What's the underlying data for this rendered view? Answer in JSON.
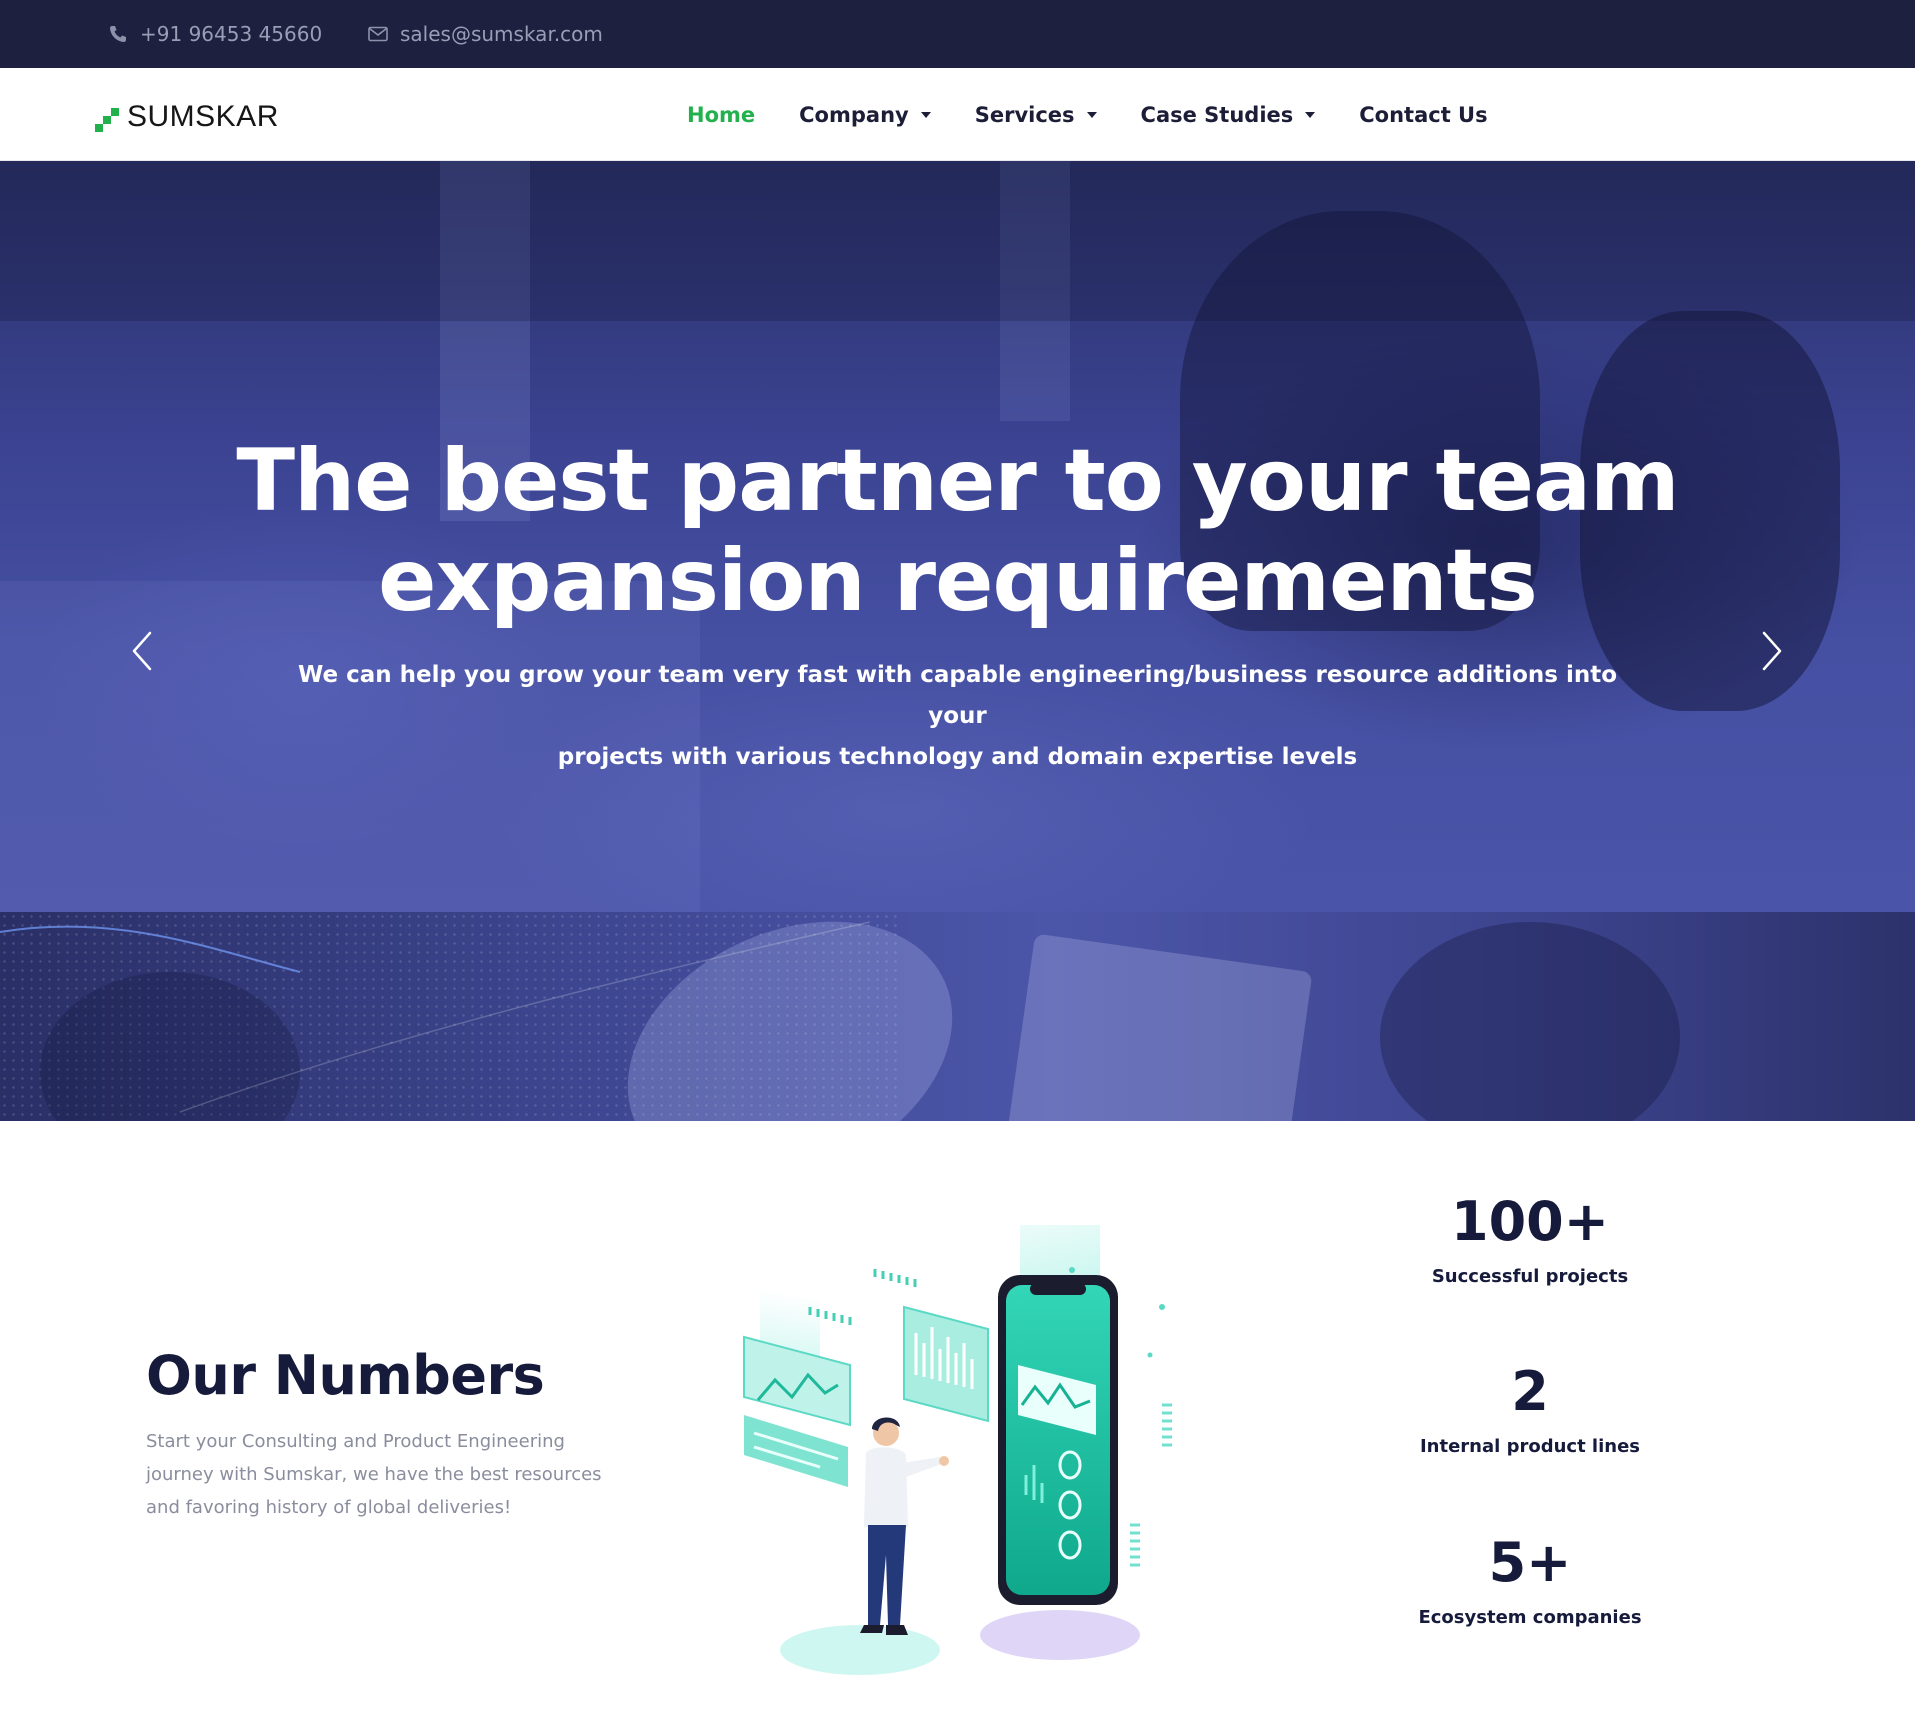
{
  "topbar": {
    "phone": "+91 96453 45660",
    "email": "sales@sumskar.com"
  },
  "brand": {
    "logo_text": "SUMSKAR",
    "accent_color": "#22b14c"
  },
  "nav": {
    "items": [
      {
        "label": "Home",
        "active": true,
        "dropdown": false
      },
      {
        "label": "Company",
        "active": false,
        "dropdown": true
      },
      {
        "label": "Services",
        "active": false,
        "dropdown": true
      },
      {
        "label": "Case Studies",
        "active": false,
        "dropdown": true
      },
      {
        "label": "Contact Us",
        "active": false,
        "dropdown": false
      }
    ]
  },
  "hero": {
    "title_line1": "The best partner to your team",
    "title_line2": "expansion requirements",
    "subtitle_line1": "We can help you grow your team very fast with capable engineering/business resource additions into your",
    "subtitle_line2": "projects with various technology and domain expertise levels",
    "prev_icon": "chevron-left-icon",
    "next_icon": "chevron-right-icon"
  },
  "numbers": {
    "title": "Our Numbers",
    "desc_line1": "Start your Consulting and Product Engineering",
    "desc_line2": "journey with Sumskar, we have the best resources",
    "desc_line3": "and favoring history of global deliveries!",
    "stats": [
      {
        "value": "100+",
        "label": "Successful projects"
      },
      {
        "value": "2",
        "label": "Internal product lines"
      },
      {
        "value": "5+",
        "label": "Ecosystem companies"
      }
    ]
  }
}
